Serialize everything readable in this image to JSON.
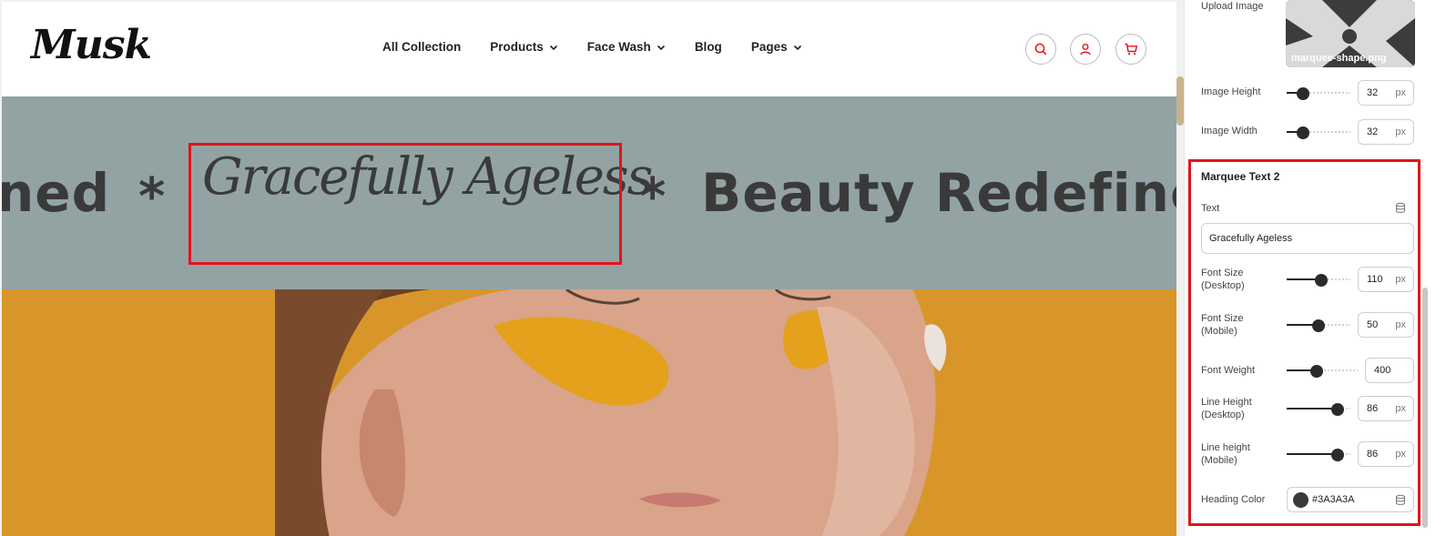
{
  "site": {
    "logo": "Musk",
    "nav": [
      {
        "label": "All Collection"
      },
      {
        "label": "Products"
      },
      {
        "label": "Face Wash"
      },
      {
        "label": "Blog"
      },
      {
        "label": "Pages"
      }
    ],
    "header_icons": [
      "search-icon",
      "user-icon",
      "cart-icon"
    ],
    "accent_color": "#e0151b"
  },
  "marquee": {
    "left_text": "ned",
    "separator": "*",
    "script_text": "Gracefully Ageless",
    "right_text": "Beauty Redefine",
    "background": "#93a3a4",
    "text_color": "#3a3a3a"
  },
  "panel": {
    "upload": {
      "label": "Upload Image",
      "file_name": "marquee-shape.png"
    },
    "image_height": {
      "label": "Image Height",
      "value": "32",
      "unit": "px",
      "slider_fraction": 0.25
    },
    "image_width": {
      "label": "Image Width",
      "value": "32",
      "unit": "px",
      "slider_fraction": 0.25
    },
    "section_title": "Marquee Text 2",
    "text": {
      "label": "Text",
      "value": "Gracefully Ageless"
    },
    "font_size_desktop": {
      "label_line1": "Font Size",
      "label_line2": "(Desktop)",
      "value": "110",
      "unit": "px",
      "slider_fraction": 0.54
    },
    "font_size_mobile": {
      "label_line1": "Font Size",
      "label_line2": "(Mobile)",
      "value": "50",
      "unit": "px",
      "slider_fraction": 0.5
    },
    "font_weight": {
      "label": "Font Weight",
      "value": "400",
      "slider_fraction": 0.42
    },
    "line_height_desktop": {
      "label_line1": "Line Height",
      "label_line2": "(Desktop)",
      "value": "86",
      "unit": "px",
      "slider_fraction": 0.8
    },
    "line_height_mobile": {
      "label_line1": "Line height",
      "label_line2": "(Mobile)",
      "value": "86",
      "unit": "px",
      "slider_fraction": 0.8
    },
    "heading_color": {
      "label": "Heading Color",
      "value": "#3A3A3A"
    }
  }
}
